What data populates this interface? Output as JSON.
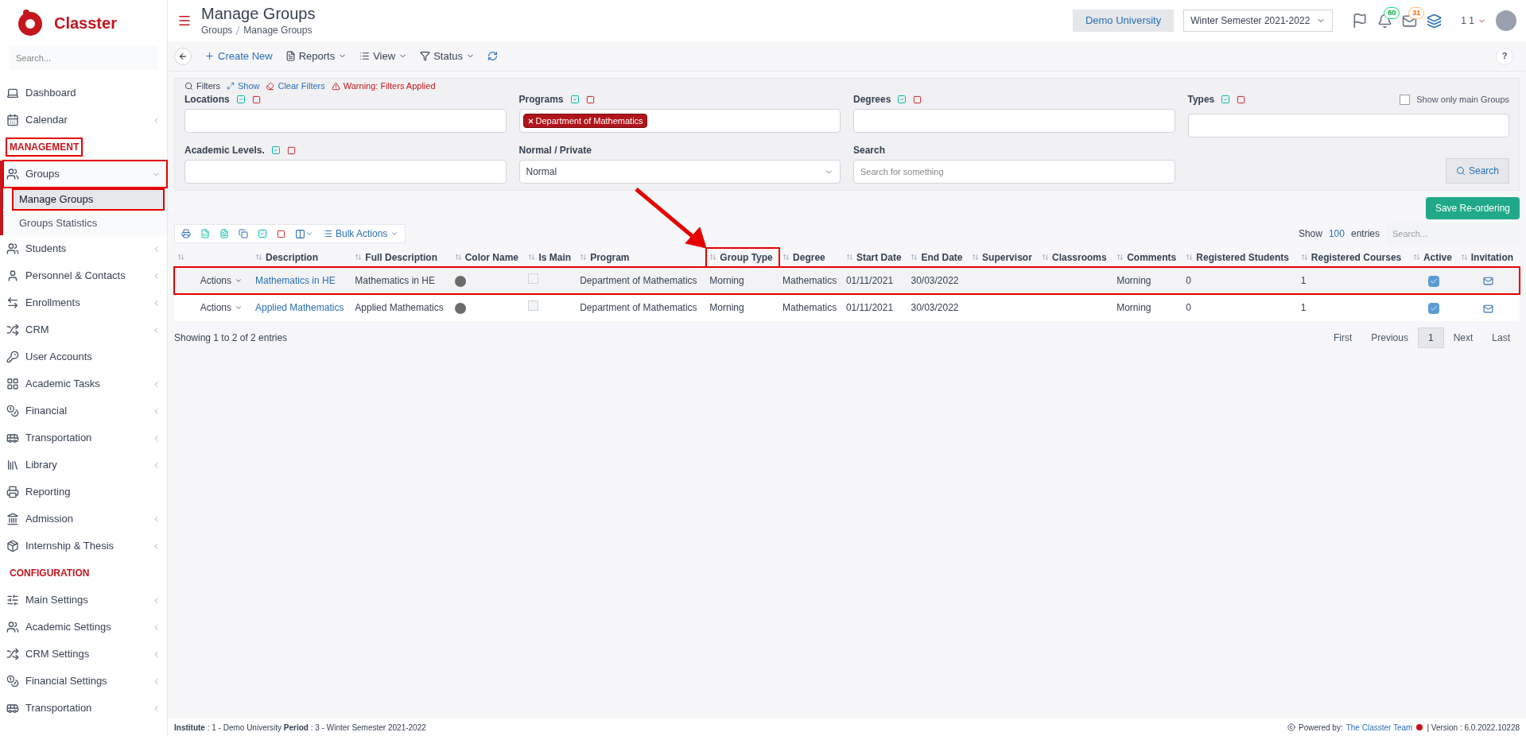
{
  "brand": {
    "name": "Classter"
  },
  "sidebar": {
    "search_placeholder": "Search...",
    "items": [
      {
        "kind": "link",
        "label": "Dashboard",
        "submenu": false
      },
      {
        "kind": "link",
        "label": "Calendar",
        "submenu": true
      },
      {
        "kind": "section",
        "label": "MANAGEMENT",
        "highlighted": true
      },
      {
        "kind": "link",
        "label": "Groups",
        "submenu": true,
        "expanded": true,
        "highlighted": true,
        "children": [
          {
            "label": "Manage Groups",
            "selected": true,
            "highlighted": true
          },
          {
            "label": "Groups Statistics",
            "selected": false,
            "highlighted": false
          }
        ]
      },
      {
        "kind": "link",
        "label": "Students",
        "submenu": true
      },
      {
        "kind": "link",
        "label": "Personnel & Contacts",
        "submenu": true
      },
      {
        "kind": "link",
        "label": "Enrollments",
        "submenu": true
      },
      {
        "kind": "link",
        "label": "CRM",
        "submenu": true
      },
      {
        "kind": "link",
        "label": "User Accounts",
        "submenu": false
      },
      {
        "kind": "link",
        "label": "Academic Tasks",
        "submenu": true
      },
      {
        "kind": "link",
        "label": "Financial",
        "submenu": true
      },
      {
        "kind": "link",
        "label": "Transportation",
        "submenu": true
      },
      {
        "kind": "link",
        "label": "Library",
        "submenu": true
      },
      {
        "kind": "link",
        "label": "Reporting",
        "submenu": false
      },
      {
        "kind": "link",
        "label": "Admission",
        "submenu": true
      },
      {
        "kind": "link",
        "label": "Internship & Thesis",
        "submenu": true
      },
      {
        "kind": "section",
        "label": "CONFIGURATION",
        "highlighted": false
      },
      {
        "kind": "link",
        "label": "Main Settings",
        "submenu": true
      },
      {
        "kind": "link",
        "label": "Academic Settings",
        "submenu": true
      },
      {
        "kind": "link",
        "label": "CRM Settings",
        "submenu": true
      },
      {
        "kind": "link",
        "label": "Financial Settings",
        "submenu": true
      },
      {
        "kind": "link",
        "label": "Transportation",
        "submenu": true
      }
    ]
  },
  "header": {
    "title": "Manage Groups",
    "breadcrumb": [
      "Groups",
      "Manage Groups"
    ],
    "institution": "Demo University",
    "period": "Winter Semester 2021-2022",
    "notifications": "60",
    "messages": "31",
    "user": "1 1"
  },
  "toolbar": {
    "buttons": [
      {
        "kind": "create",
        "label": "Create New"
      },
      {
        "kind": "reports",
        "label": "Reports"
      },
      {
        "kind": "view",
        "label": "View"
      },
      {
        "kind": "status",
        "label": "Status"
      }
    ],
    "help": "?"
  },
  "filters": {
    "title": "Filters",
    "show": "Show",
    "clear": "Clear Filters",
    "warning": "Warning: Filters Applied",
    "fields": [
      {
        "kind": "multi",
        "label": "Locations"
      },
      {
        "kind": "multi",
        "label": "Programs",
        "tags": [
          "Department of Mathematics"
        ]
      },
      {
        "kind": "multi",
        "label": "Degrees"
      },
      {
        "kind": "multi",
        "label": "Types"
      },
      {
        "kind": "multi",
        "label": "Academic Levels."
      },
      {
        "kind": "select",
        "label": "Normal / Private",
        "value": "Normal"
      },
      {
        "kind": "text",
        "label": "Search",
        "placeholder": "Search for something"
      }
    ],
    "main_only": {
      "label": "Show only main Groups",
      "checked": false
    },
    "search_button": "Search"
  },
  "save_button": "Save Re-ordering",
  "table": {
    "bulk_actions": "Bulk Actions",
    "show": "Show",
    "entries_count": "100",
    "entries": "entries",
    "search_placeholder": "Search...",
    "columns": [
      {
        "highlighted": false
      },
      {
        "label": "Description",
        "highlighted": false
      },
      {
        "label": "Full Description",
        "highlighted": false
      },
      {
        "label": "Color Name",
        "highlighted": false
      },
      {
        "label": "Is Main",
        "highlighted": false
      },
      {
        "label": "Program",
        "highlighted": false
      },
      {
        "label": "Group Type",
        "highlighted": true
      },
      {
        "label": "Degree",
        "highlighted": false
      },
      {
        "label": "Start Date",
        "highlighted": false
      },
      {
        "label": "End Date",
        "highlighted": false
      },
      {
        "label": "Supervisor",
        "highlighted": false
      },
      {
        "label": "Classrooms",
        "highlighted": false
      },
      {
        "label": "Comments",
        "highlighted": false
      },
      {
        "label": "Registered Students",
        "highlighted": false
      },
      {
        "label": "Registered Courses",
        "highlighted": false
      },
      {
        "label": "Active",
        "highlighted": false
      },
      {
        "label": "Invitation",
        "highlighted": false
      }
    ],
    "rows": [
      {
        "actions": "Actions",
        "description": "Mathematics in HE",
        "full_description": "Mathematics in HE",
        "color": "#6b6b6b",
        "is_main": false,
        "program": "Department of Mathematics",
        "group_type": "Morning",
        "degree": "Mathematics",
        "start_date": "01/11/2021",
        "end_date": "30/03/2022",
        "comments": "Morning",
        "registered_students": "0",
        "registered_courses": "1",
        "active": true,
        "highlighted": true
      },
      {
        "actions": "Actions",
        "description": "Applied Mathematics",
        "full_description": "Applied Mathematics",
        "color": "#6b6b6b",
        "is_main": false,
        "program": "Department of Mathematics",
        "group_type": "Morning",
        "degree": "Mathematics",
        "start_date": "01/11/2021",
        "end_date": "30/03/2022",
        "comments": "Morning",
        "registered_students": "0",
        "registered_courses": "1",
        "active": true,
        "highlighted": false
      }
    ],
    "summary": "Showing 1 to 2 of 2 entries",
    "pagination": [
      {
        "label": "First",
        "selected": false
      },
      {
        "label": "Previous",
        "selected": false
      },
      {
        "label": "1",
        "selected": true
      },
      {
        "label": "Next",
        "selected": false
      },
      {
        "label": "Last",
        "selected": false
      }
    ]
  },
  "footer": {
    "info": "**Institute** : 1 - Demo University **Period** : 3 - Winter Semester 2021-2022",
    "powered": "Powered by:",
    "team": "The Classter Team",
    "version": "| Version : 6.0.2022.10228"
  }
}
